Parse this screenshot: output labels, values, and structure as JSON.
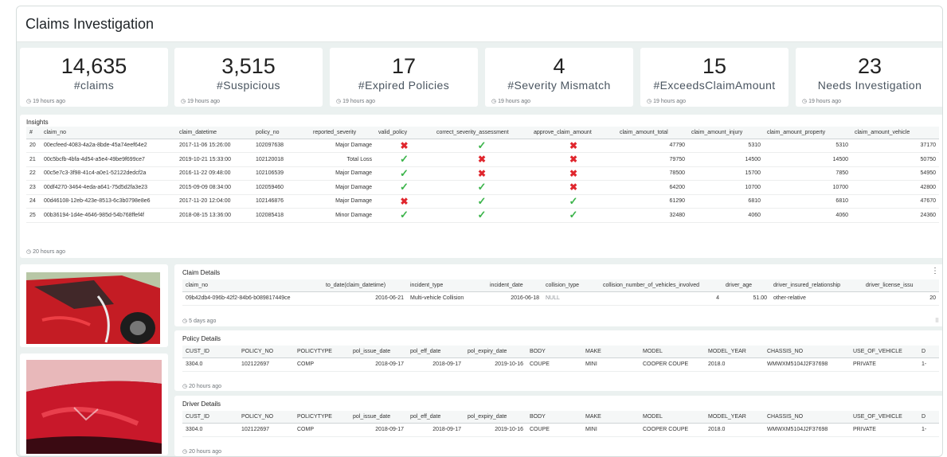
{
  "header": {
    "title": "Claims Investigation"
  },
  "kpis": [
    {
      "value": "14,635",
      "label": "#claims",
      "updated": "19 hours ago"
    },
    {
      "value": "3,515",
      "label": "#Suspicious",
      "updated": "19 hours ago"
    },
    {
      "value": "17",
      "label": "#Expired Policies",
      "updated": "19 hours ago"
    },
    {
      "value": "4",
      "label": "#Severity Mismatch",
      "updated": "19 hours ago"
    },
    {
      "value": "15",
      "label": "#ExceedsClaimAmount",
      "updated": "19 hours ago"
    },
    {
      "value": "23",
      "label": "Needs Investigation",
      "updated": "19 hours ago"
    }
  ],
  "insights": {
    "title": "Insights",
    "columns": [
      "#",
      "claim_no",
      "claim_datetime",
      "policy_no",
      "reported_severity",
      "valid_policy",
      "correct_severity_assessment",
      "approve_claim_amount",
      "claim_amount_total",
      "claim_amount_injury",
      "claim_amount_property",
      "claim_amount_vehicle"
    ],
    "rows": [
      {
        "idx": "20",
        "claim_no": "00ecfeed-4083-4a2a-8bde-45a74eef64e2",
        "claim_datetime": "2017-11-06 15:26:00",
        "policy_no": "102097638",
        "reported_severity": "Major Damage",
        "valid_policy": "no",
        "correct_severity": "yes",
        "approve_amount": "no",
        "total": "47790",
        "injury": "5310",
        "property": "5310",
        "vehicle": "37170"
      },
      {
        "idx": "21",
        "claim_no": "00c5bcfb-4bfa-4d54-a5e4-49be9f699ce7",
        "claim_datetime": "2019-10-21 15:33:00",
        "policy_no": "102120018",
        "reported_severity": "Total Loss",
        "valid_policy": "yes",
        "correct_severity": "no",
        "approve_amount": "no",
        "total": "79750",
        "injury": "14500",
        "property": "14500",
        "vehicle": "50750"
      },
      {
        "idx": "22",
        "claim_no": "00c5e7c3-3f98-41c4-a0e1-52122dedcf2a",
        "claim_datetime": "2016-11-22 09:48:00",
        "policy_no": "102106539",
        "reported_severity": "Major Damage",
        "valid_policy": "yes",
        "correct_severity": "no",
        "approve_amount": "no",
        "total": "78500",
        "injury": "15700",
        "property": "7850",
        "vehicle": "54950"
      },
      {
        "idx": "23",
        "claim_no": "00df4270-3464-4eda-a641-75d5d2fa3e23",
        "claim_datetime": "2015-09-09 08:34:00",
        "policy_no": "102059460",
        "reported_severity": "Major Damage",
        "valid_policy": "yes",
        "correct_severity": "yes",
        "approve_amount": "no",
        "total": "64200",
        "injury": "10700",
        "property": "10700",
        "vehicle": "42800"
      },
      {
        "idx": "24",
        "claim_no": "00d46108-12eb-423e-8513-6c3b0798e8e6",
        "claim_datetime": "2017-11-20 12:04:00",
        "policy_no": "102146876",
        "reported_severity": "Major Damage",
        "valid_policy": "no",
        "correct_severity": "yes",
        "approve_amount": "yes",
        "total": "61290",
        "injury": "6810",
        "property": "6810",
        "vehicle": "47670"
      },
      {
        "idx": "25",
        "claim_no": "00b36194-1d4e-4646-985d-54b768ffef4f",
        "claim_datetime": "2018-08-15 13:36:00",
        "policy_no": "102085418",
        "reported_severity": "Minor Damage",
        "valid_policy": "yes",
        "correct_severity": "yes",
        "approve_amount": "yes",
        "total": "32480",
        "injury": "4060",
        "property": "4060",
        "vehicle": "24360"
      }
    ],
    "pages": [
      "1",
      "2",
      "3",
      ">"
    ],
    "updated": "20 hours ago"
  },
  "claim_details": {
    "title": "Claim Details",
    "columns": [
      "claim_no",
      "to_date(claim_datetime)",
      "incident_type",
      "incident_date",
      "collision_type",
      "collision_number_of_vehicles_involved",
      "driver_age",
      "driver_insured_relationship",
      "driver_license_issu"
    ],
    "row": [
      "09b42db4-096b-42f2-84b6-b089817449ce",
      "2016-06-21",
      "Multi-vehicle Collision",
      "2016-06-18",
      "NULL",
      "4",
      "51.00",
      "other-relative",
      "20"
    ],
    "updated": "5 days ago"
  },
  "policy_details": {
    "title": "Policy Details",
    "columns": [
      "CUST_ID",
      "POLICY_NO",
      "POLICYTYPE",
      "pol_issue_date",
      "pol_eff_date",
      "pol_expiry_date",
      "BODY",
      "MAKE",
      "MODEL",
      "MODEL_YEAR",
      "CHASSIS_NO",
      "USE_OF_VEHICLE",
      "D"
    ],
    "row": [
      "3304.0",
      "102122697",
      "COMP",
      "2018-09-17",
      "2018-09-17",
      "2019-10-16",
      "COUPE",
      "MINI",
      "COOPER COUPE",
      "2018.0",
      "WMWXM5104J2F37698",
      "PRIVATE",
      "1-"
    ],
    "updated": "20 hours ago"
  },
  "driver_details": {
    "title": "Driver Details",
    "columns": [
      "CUST_ID",
      "POLICY_NO",
      "POLICYTYPE",
      "pol_issue_date",
      "pol_eff_date",
      "pol_expiry_date",
      "BODY",
      "MAKE",
      "MODEL",
      "MODEL_YEAR",
      "CHASSIS_NO",
      "USE_OF_VEHICLE",
      "D"
    ],
    "row": [
      "3304.0",
      "102122697",
      "COMP",
      "2018-09-17",
      "2018-09-17",
      "2019-10-16",
      "COUPE",
      "MINI",
      "COOPER COUPE",
      "2018.0",
      "WMWXM5104J2F37698",
      "PRIVATE",
      "1-"
    ],
    "updated": "20 hours ago"
  },
  "icons": {
    "clock": "clock-icon",
    "menu": "kebab-menu-icon",
    "resize": "resize-handle-icon"
  },
  "colors": {
    "yes": "#3bb44a",
    "no": "#e0262d",
    "background": "#ebf1f0"
  }
}
